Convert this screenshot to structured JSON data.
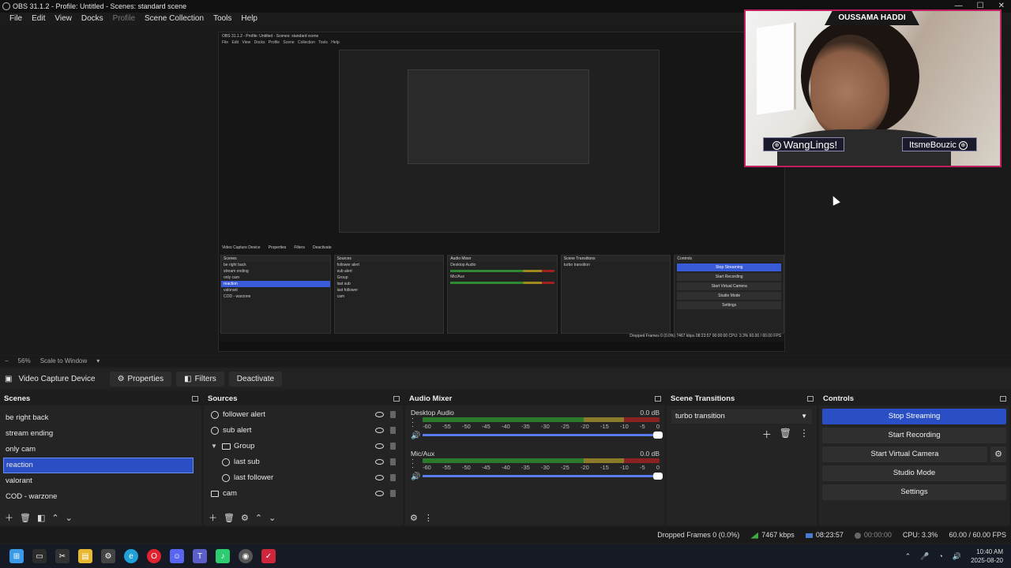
{
  "window": {
    "title": "OBS 31.1.2 - Profile: Untitled - Scenes: standard scene",
    "controls": [
      "—",
      "☐",
      "✕"
    ]
  },
  "menu": [
    "File",
    "Edit",
    "View",
    "Docks",
    "Profile",
    "Scene Collection",
    "Tools",
    "Help"
  ],
  "overlay": {
    "name_tag": "OUSSAMA HADDI",
    "label_left": "WangLings!",
    "label_right": "ItsmeBouzic"
  },
  "nested_preview": {
    "title": "OBS 31.1.2 - Profile: Untitled - Scenes: standard scene",
    "menu": "File  Edit  View  Docks  Profile  Scene Collection  Tools  Help",
    "toolbar": [
      "Video Capture Device",
      "Properties",
      "Filters",
      "Deactivate"
    ],
    "scenes": [
      "be right back",
      "stream ending",
      "only cam",
      "reaction",
      "valorant",
      "COD - warzone"
    ],
    "sources": [
      "follower alert",
      "sub alert",
      "Group",
      "last sub",
      "last follower",
      "cam"
    ],
    "controls": [
      "Stop Streaming",
      "Start Recording",
      "Start Virtual Camera",
      "Studio Mode",
      "Settings"
    ],
    "transition": "turbo transition",
    "status": "Dropped Frames 0 (0.0%)   7467 kbps   08:23:57   00:00:00   CPU: 3.3%   60.00 / 60.00 FPS"
  },
  "zoom": {
    "level": "56%",
    "mode": "Scale to Window"
  },
  "source_toolbar": {
    "source_name": "Video Capture Device",
    "properties": "Properties",
    "filters": "Filters",
    "deactivate": "Deactivate"
  },
  "scenes": {
    "title": "Scenes",
    "items": [
      "be right back",
      "stream ending",
      "only cam",
      "reaction",
      "valorant",
      "COD - warzone"
    ],
    "selected": "reaction"
  },
  "sources": {
    "title": "Sources",
    "items": [
      {
        "label": "follower alert",
        "type": "alert"
      },
      {
        "label": "sub alert",
        "type": "alert"
      },
      {
        "label": "Group",
        "type": "group"
      },
      {
        "label": "last sub",
        "type": "alert"
      },
      {
        "label": "last follower",
        "type": "alert"
      },
      {
        "label": "cam",
        "type": "camera"
      }
    ]
  },
  "audio_mixer": {
    "title": "Audio Mixer",
    "tracks": [
      {
        "name": "Desktop Audio",
        "db": "0.0 dB"
      },
      {
        "name": "Mic/Aux",
        "db": "0.0 dB"
      }
    ],
    "scale": [
      "-60",
      "-55",
      "-50",
      "-45",
      "-40",
      "-35",
      "-30",
      "-25",
      "-20",
      "-15",
      "-10",
      "-5",
      "0"
    ]
  },
  "scene_transitions": {
    "title": "Scene Transitions",
    "selected": "turbo transition"
  },
  "controls": {
    "title": "Controls",
    "stop_streaming": "Stop Streaming",
    "start_recording": "Start Recording",
    "start_virtual_camera": "Start Virtual Camera",
    "studio_mode": "Studio Mode",
    "settings": "Settings"
  },
  "status": {
    "dropped_frames": "Dropped Frames 0 (0.0%)",
    "bitrate": "7467 kbps",
    "stream_time": "08:23:57",
    "record_time": "00:00:00",
    "cpu": "CPU: 3.3%",
    "fps": "60.00 / 60.00 FPS"
  },
  "taskbar": {
    "time": "10:40 AM",
    "date": "2025-08-20",
    "colors": {
      "windows": "#3a9ae8",
      "files": "#e8b930",
      "edge": "#1fa0d8",
      "opera": "#e0232e",
      "discord": "#5865f2",
      "teams": "#5b5fc7",
      "spotify_like": "#2ecc71",
      "obs": "#555555",
      "red_app": "#d0263b"
    }
  },
  "colors": {
    "accent": "#2a4ec4",
    "overlay_border": "#c02060"
  }
}
